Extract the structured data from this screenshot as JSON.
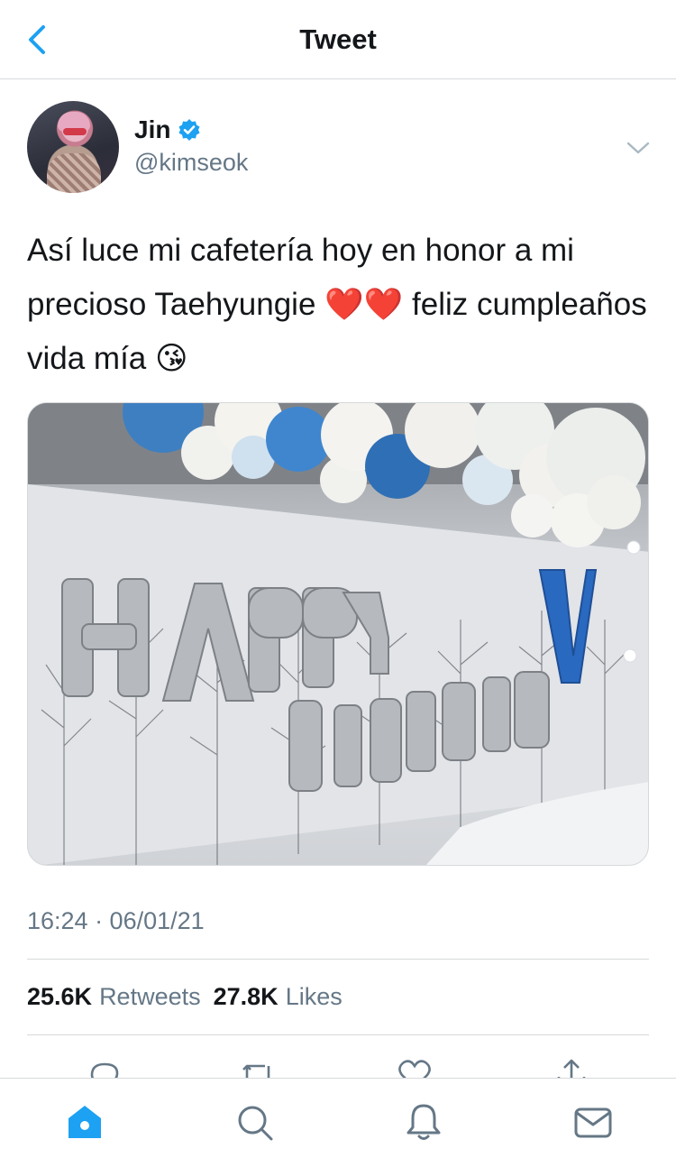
{
  "header": {
    "title": "Tweet",
    "back_icon": "chevron-left-icon",
    "accent": "#1da1f2"
  },
  "tweet": {
    "author": {
      "display_name": "Jin",
      "handle": "@kimseok",
      "verified": true
    },
    "text": "Así luce mi cafetería hoy en honor a mi precioso Taehyungie ❤️❤️ feliz cumpleaños vida mía 😘",
    "timestamp": "16:24 · 06/01/21",
    "media": {
      "balloon_letters_top": "HAPPY",
      "balloon_letters_bottom": "BIRTHDAY",
      "balloon_letter_blue": "V"
    },
    "stats": {
      "retweets_count": "25.6K",
      "retweets_label": "Retweets",
      "likes_count": "27.8K",
      "likes_label": "Likes"
    }
  },
  "actions": [
    "reply-icon",
    "retweet-icon",
    "like-icon",
    "share-icon"
  ],
  "tabbar": [
    "home-icon",
    "search-icon",
    "notifications-icon",
    "messages-icon"
  ],
  "colors": {
    "text_primary": "#14171a",
    "text_secondary": "#657786",
    "divider": "#d6d9db",
    "accent": "#1da1f2"
  }
}
